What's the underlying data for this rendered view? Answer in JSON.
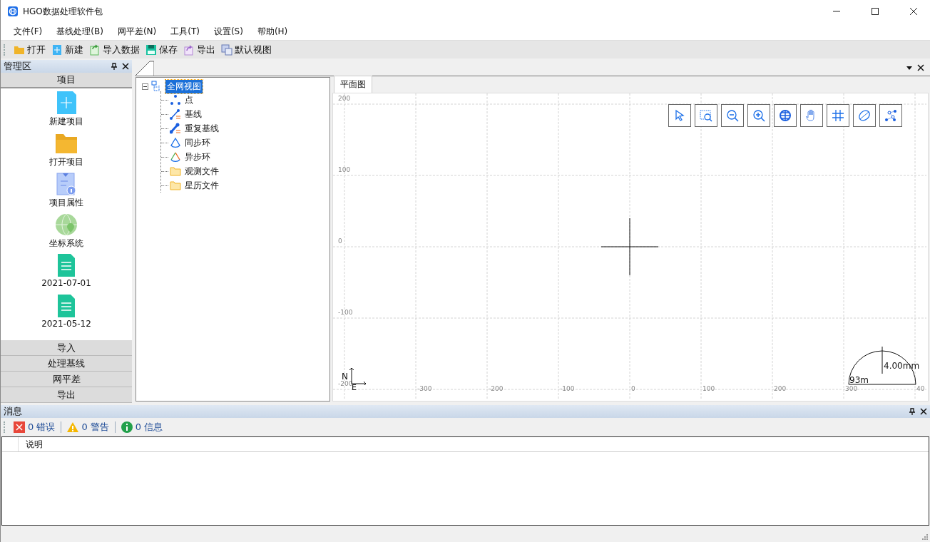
{
  "window": {
    "title": "HGO数据处理软件包"
  },
  "menu": [
    "文件(F)",
    "基线处理(B)",
    "网平差(N)",
    "工具(T)",
    "设置(S)",
    "帮助(H)"
  ],
  "toolbar": [
    {
      "label": "打开",
      "kind": "open"
    },
    {
      "label": "新建",
      "kind": "new"
    },
    {
      "label": "导入数据",
      "kind": "import"
    },
    {
      "label": "保存",
      "kind": "save"
    },
    {
      "label": "导出",
      "kind": "export"
    },
    {
      "label": "默认视图",
      "kind": "view"
    }
  ],
  "manager_panel": {
    "title": "管理区",
    "sections": [
      {
        "label": "项目",
        "expanded": true,
        "items": [
          {
            "label": "新建项目",
            "kind": "new"
          },
          {
            "label": "打开项目",
            "kind": "folder"
          },
          {
            "label": "项目属性",
            "kind": "info"
          },
          {
            "label": "坐标系统",
            "kind": "globe"
          },
          {
            "label": "2021-07-01",
            "kind": "file"
          },
          {
            "label": "2021-05-12",
            "kind": "file"
          }
        ]
      },
      {
        "label": "导入",
        "expanded": false
      },
      {
        "label": "处理基线",
        "expanded": false
      },
      {
        "label": "网平差",
        "expanded": false
      },
      {
        "label": "导出",
        "expanded": false
      }
    ]
  },
  "tree": {
    "label": "全网视图",
    "selected": true,
    "expanded": true,
    "children": [
      {
        "label": "点",
        "kind": "points"
      },
      {
        "label": "基线",
        "kind": "baseline"
      },
      {
        "label": "重复基线",
        "kind": "repeat"
      },
      {
        "label": "同步环",
        "kind": "sync"
      },
      {
        "label": "异步环",
        "kind": "async"
      },
      {
        "label": "观测文件",
        "kind": "folder"
      },
      {
        "label": "星历文件",
        "kind": "folder"
      }
    ]
  },
  "plot": {
    "tab": "平面图",
    "x_ticks": [
      "-300",
      "-200",
      "-100",
      "0",
      "100",
      "200",
      "300",
      "40"
    ],
    "y_ticks": [
      "200",
      "100",
      "0",
      "-100",
      "-200"
    ],
    "north": "N",
    "east": "E",
    "scale": {
      "height": "4.00mm",
      "width": "93m"
    },
    "tools": [
      {
        "kind": "select"
      },
      {
        "kind": "zoom-box"
      },
      {
        "kind": "zoom-out"
      },
      {
        "kind": "zoom-in"
      },
      {
        "kind": "globe"
      },
      {
        "kind": "pan"
      },
      {
        "kind": "grid"
      },
      {
        "kind": "ellipse"
      },
      {
        "kind": "network"
      }
    ]
  },
  "messages": {
    "title": "消息",
    "filters": [
      {
        "label": "0 错误",
        "kind": "error"
      },
      {
        "label": "0 警告",
        "kind": "warning"
      },
      {
        "label": "0 信息",
        "kind": "info"
      }
    ],
    "columns": [
      "说明"
    ]
  }
}
